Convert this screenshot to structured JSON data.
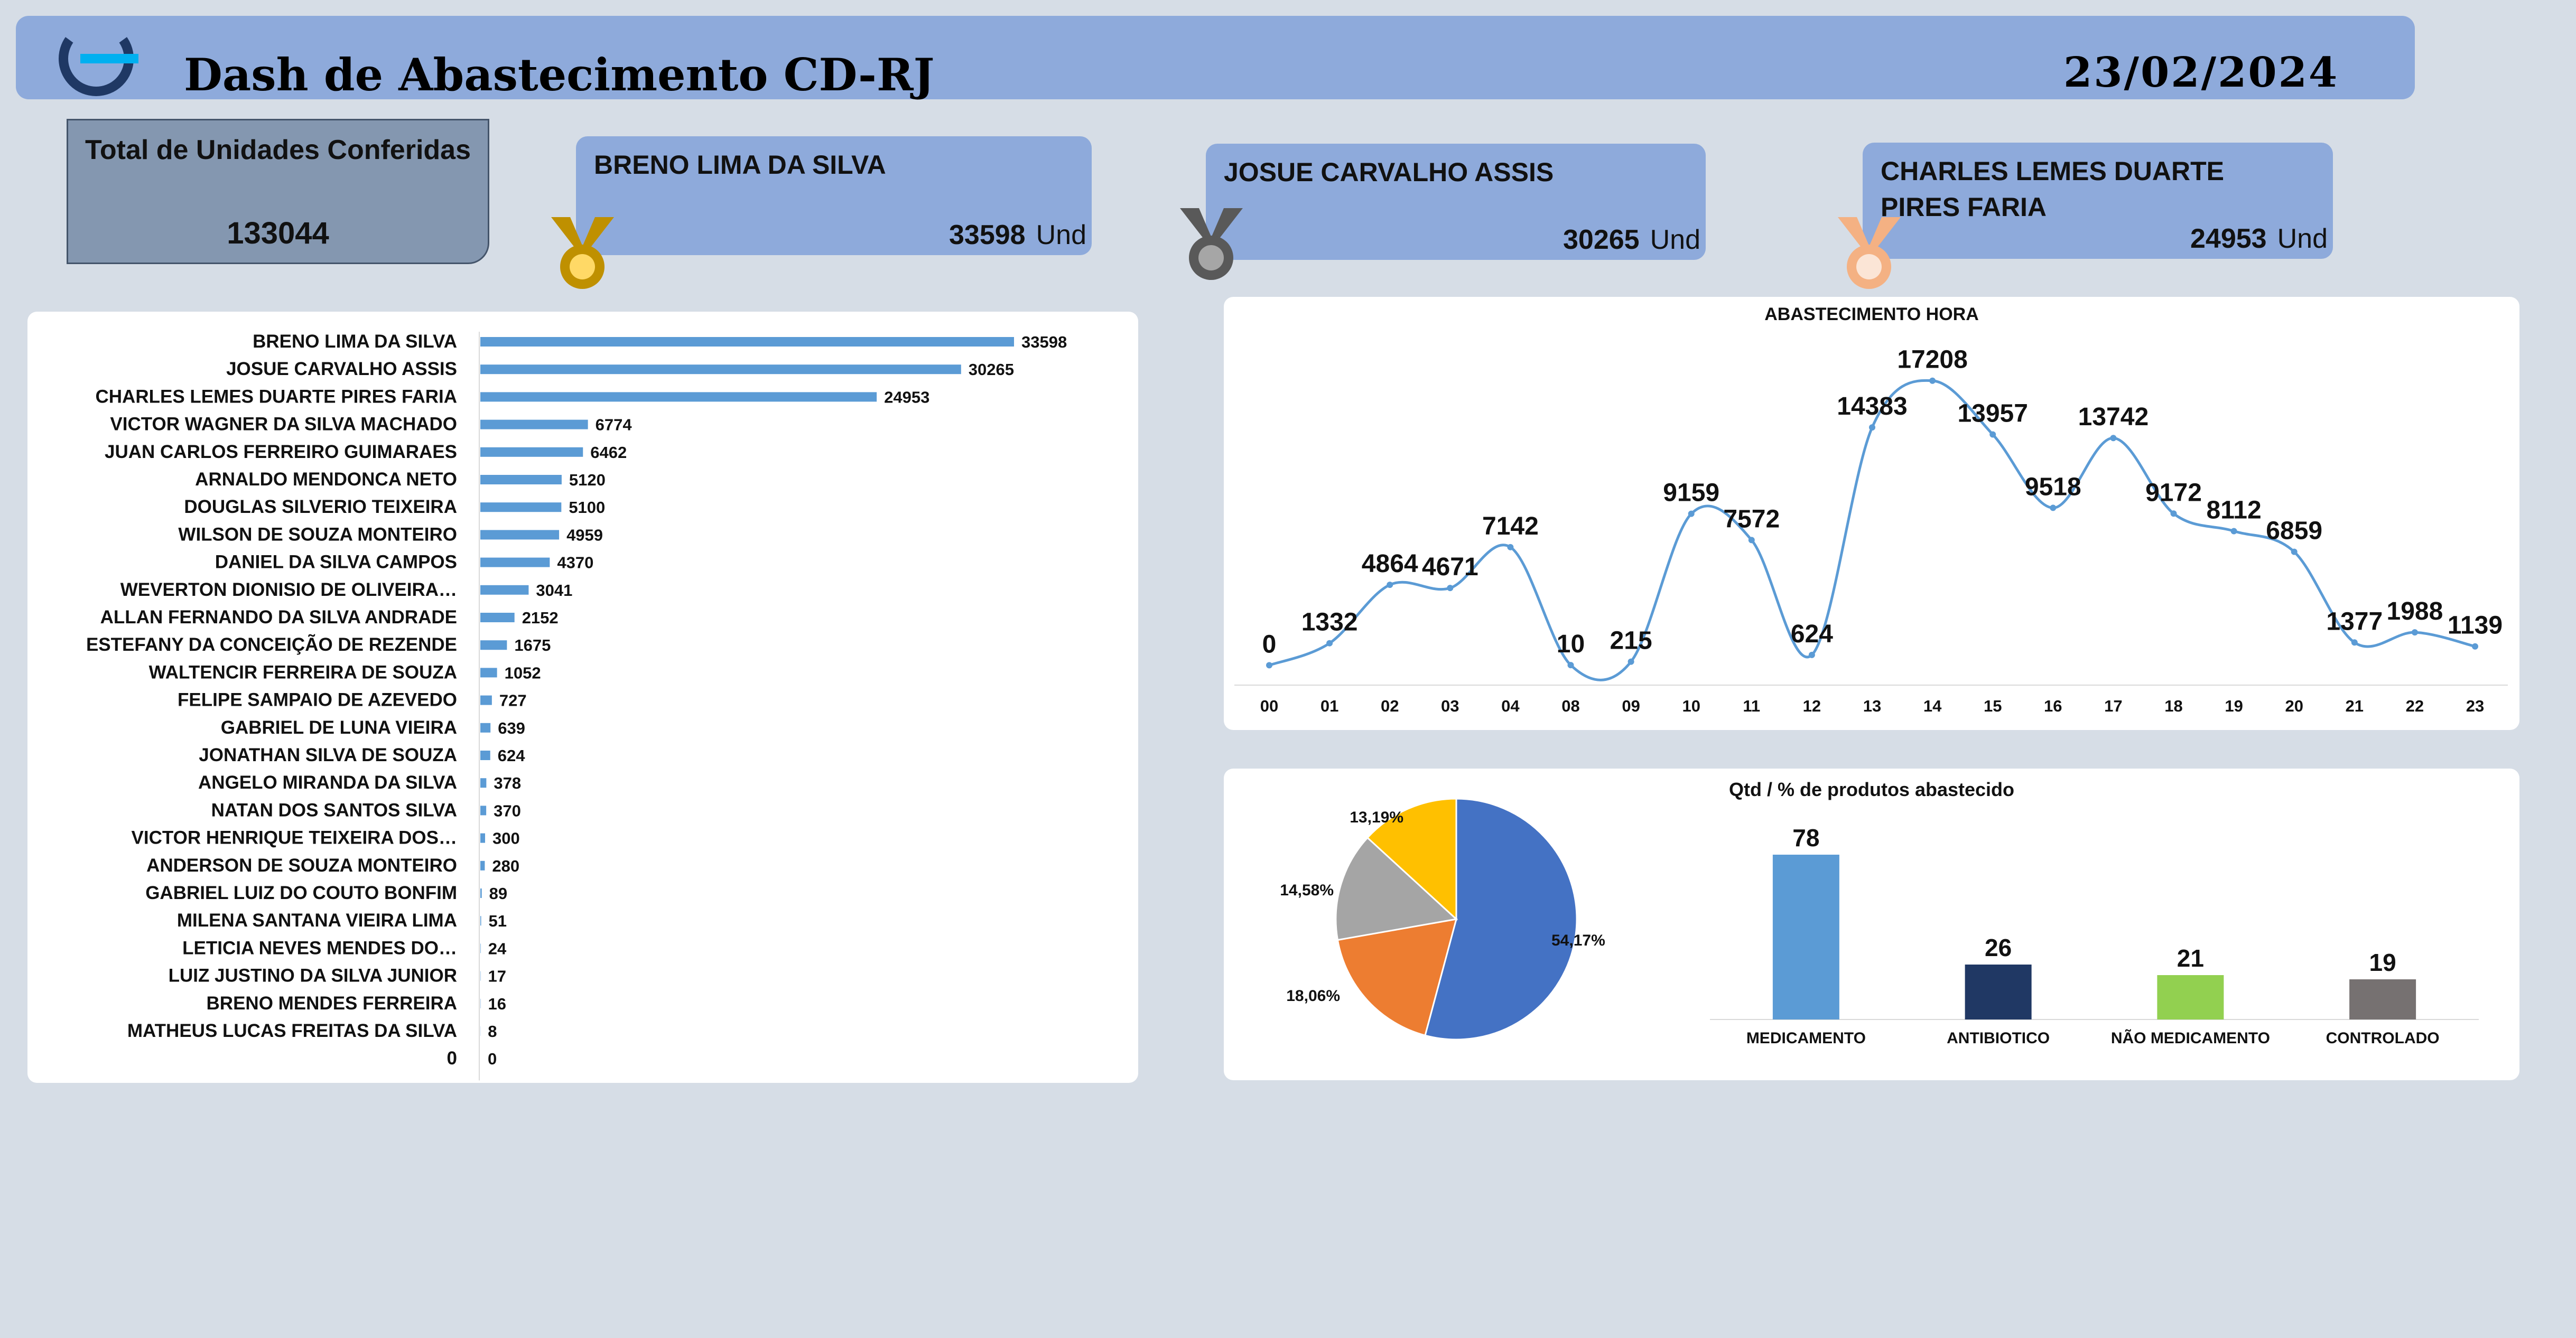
{
  "header": {
    "title": "Dash de Abastecimento CD-RJ",
    "date": "23/02/2024"
  },
  "total": {
    "label": "Total de Unidades Conferidas",
    "value": "133044"
  },
  "podium": [
    {
      "name": "BRENO LIMA DA SILVA",
      "value": "33598",
      "unit": "Und",
      "medal": "gold-medal-icon"
    },
    {
      "name": "JOSUE CARVALHO ASSIS",
      "value": "30265",
      "unit": "Und",
      "medal": "silver-medal-icon"
    },
    {
      "name": "CHARLES LEMES DUARTE PIRES FARIA",
      "value": "24953",
      "unit": "Und",
      "medal": "bronze-medal-icon"
    }
  ],
  "colors": {
    "header": "#8eaadb",
    "bar": "#5b9bd5",
    "line": "#5b9bd5",
    "gold": "#bf9000",
    "silver": "#7f7f7f",
    "bronze": "#f4b183",
    "pie": [
      "#4472c4",
      "#ed7d31",
      "#a5a5a5",
      "#ffc000"
    ],
    "categories": [
      "#5b9bd5",
      "#203864",
      "#92d050",
      "#767171"
    ]
  },
  "chart_data": [
    {
      "type": "bar",
      "orientation": "horizontal",
      "categories": [
        "BRENO LIMA DA SILVA",
        "JOSUE CARVALHO ASSIS",
        "CHARLES LEMES DUARTE PIRES FARIA",
        "VICTOR WAGNER DA SILVA MACHADO",
        "JUAN CARLOS FERREIRO GUIMARAES",
        "ARNALDO MENDONCA NETO",
        "DOUGLAS SILVERIO TEIXEIRA",
        "WILSON DE SOUZA MONTEIRO",
        "DANIEL DA SILVA CAMPOS",
        "WEVERTON DIONISIO DE OLIVEIRA…",
        "ALLAN FERNANDO DA SILVA ANDRADE",
        "ESTEFANY DA CONCEIÇÃO DE REZENDE",
        "WALTENCIR FERREIRA DE SOUZA",
        "FELIPE SAMPAIO DE AZEVEDO",
        "GABRIEL DE LUNA VIEIRA",
        "JONATHAN SILVA DE SOUZA",
        "ANGELO MIRANDA DA SILVA",
        "NATAN DOS SANTOS SILVA",
        "VICTOR HENRIQUE TEIXEIRA DOS…",
        "ANDERSON DE SOUZA MONTEIRO",
        "GABRIEL LUIZ DO COUTO BONFIM",
        "MILENA SANTANA VIEIRA LIMA",
        "LETICIA NEVES MENDES DO…",
        "LUIZ JUSTINO DA SILVA JUNIOR",
        "BRENO MENDES FERREIRA",
        "MATHEUS LUCAS FREITAS DA SILVA",
        "0"
      ],
      "values": [
        33598,
        30265,
        24953,
        6774,
        6462,
        5120,
        5100,
        4959,
        4370,
        3041,
        2152,
        1675,
        1052,
        727,
        639,
        624,
        378,
        370,
        300,
        280,
        89,
        51,
        24,
        17,
        16,
        8,
        0
      ],
      "xlim": [
        0,
        42000
      ]
    },
    {
      "type": "line",
      "title": "ABASTECIMENTO  HORA",
      "x": [
        "00",
        "01",
        "02",
        "03",
        "04",
        "08",
        "09",
        "10",
        "11",
        "12",
        "13",
        "14",
        "15",
        "16",
        "17",
        "18",
        "19",
        "20",
        "21",
        "22",
        "23"
      ],
      "values": [
        0,
        1332,
        4864,
        4671,
        7142,
        10,
        215,
        9159,
        7572,
        624,
        14383,
        17208,
        13957,
        9518,
        13742,
        9172,
        8112,
        6859,
        1377,
        1988,
        1139
      ],
      "ylim": [
        -2000,
        21000
      ],
      "smooth": true
    },
    {
      "type": "pie",
      "labels": [
        "54,17%",
        "18,06%",
        "14,58%",
        "13,19%"
      ],
      "values": [
        54.17,
        18.06,
        14.58,
        13.19
      ]
    },
    {
      "type": "bar",
      "title": "Qtd / % de produtos abastecido",
      "categories": [
        "MEDICAMENTO",
        "ANTIBIOTICO",
        "NÃO MEDICAMENTO",
        "CONTROLADO"
      ],
      "values": [
        78,
        26,
        21,
        19
      ],
      "ylim": [
        0,
        90
      ]
    }
  ]
}
